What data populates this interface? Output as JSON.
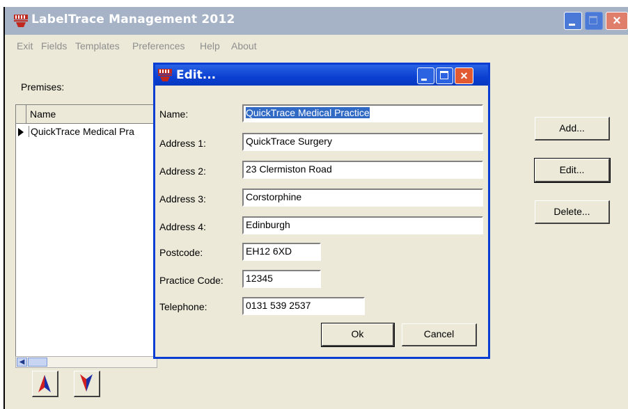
{
  "window": {
    "title": "LabelTrace Management 2012",
    "menu": [
      "Exit",
      "Fields",
      "Templates",
      "Preferences",
      "Help",
      "About"
    ]
  },
  "main": {
    "premises_label": "Premises:",
    "grid": {
      "columns": [
        "Name"
      ],
      "rows": [
        [
          "QuickTrace Medical Pra"
        ]
      ]
    },
    "buttons": {
      "add": "Add...",
      "edit": "Edit...",
      "delete": "Delete..."
    }
  },
  "dialog": {
    "title": "Edit...",
    "fields": [
      {
        "label": "Name:",
        "value": "QuickTrace Medical Practice"
      },
      {
        "label": "Address 1:",
        "value": "QuickTrace Surgery"
      },
      {
        "label": "Address 2:",
        "value": "23 Clermiston Road"
      },
      {
        "label": "Address 3:",
        "value": "Corstorphine"
      },
      {
        "label": "Address 4:",
        "value": "Edinburgh"
      },
      {
        "label": "Postcode:",
        "value": "EH12 6XD"
      },
      {
        "label": "Practice Code:",
        "value": "12345"
      },
      {
        "label": "Telephone:",
        "value": "0131 539 2537"
      }
    ],
    "buttons": {
      "ok": "Ok",
      "cancel": "Cancel"
    }
  },
  "colors": {
    "dialog_title": "#0a3fd0",
    "main_title_inactive": "#a6b2c6",
    "selection": "#316ac5",
    "close_button": "#e25a32"
  }
}
